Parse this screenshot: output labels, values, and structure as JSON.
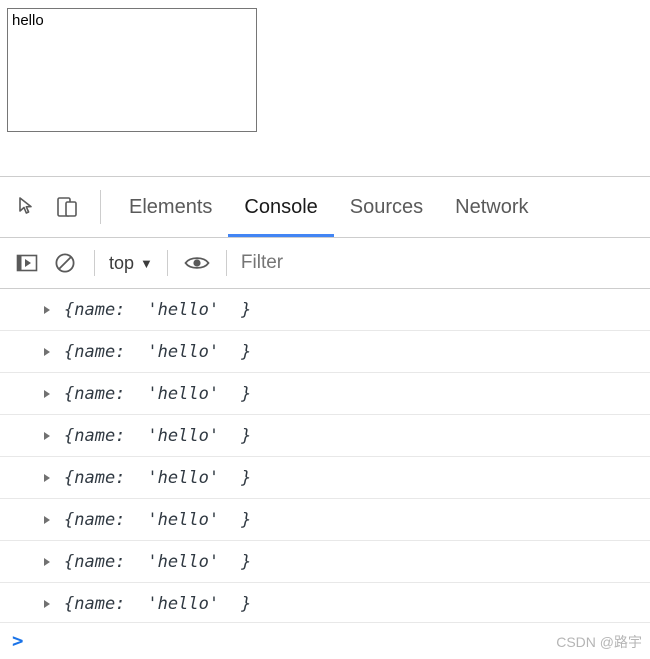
{
  "page": {
    "textbox_value": "hello",
    "textbox_placeholder": ""
  },
  "devtools": {
    "icons": {
      "inspect": "inspect-element-icon",
      "device": "device-toolbar-icon",
      "execute": "execute-snippet-icon",
      "clear": "clear-console-icon",
      "eye": "live-expression-icon"
    },
    "tabs": [
      {
        "label": "Elements",
        "active": false
      },
      {
        "label": "Console",
        "active": true
      },
      {
        "label": "Sources",
        "active": false
      },
      {
        "label": "Network",
        "active": false
      }
    ],
    "filterbar": {
      "context": "top",
      "filter_placeholder": "Filter",
      "filter_value": ""
    },
    "console": {
      "prompt": ">",
      "messages": [
        {
          "prefix": "{name:",
          "value": "'hello'",
          "suffix": "}"
        },
        {
          "prefix": "{name:",
          "value": "'hello'",
          "suffix": "}"
        },
        {
          "prefix": "{name:",
          "value": "'hello'",
          "suffix": "}"
        },
        {
          "prefix": "{name:",
          "value": "'hello'",
          "suffix": "}"
        },
        {
          "prefix": "{name:",
          "value": "'hello'",
          "suffix": "}"
        },
        {
          "prefix": "{name:",
          "value": "'hello'",
          "suffix": "}"
        },
        {
          "prefix": "{name:",
          "value": "'hello'",
          "suffix": "}"
        },
        {
          "prefix": "{name:",
          "value": "'hello'",
          "suffix": "}"
        }
      ]
    }
  },
  "watermark": "CSDN @路宇"
}
